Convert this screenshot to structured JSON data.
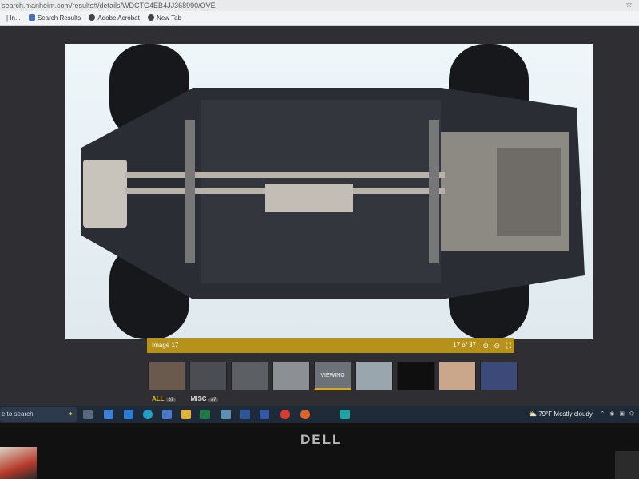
{
  "browser": {
    "url": "search.manheim.com/results#/details/WDCTG4EB4JJ368990/OVE",
    "bookmarks": [
      {
        "label": "| In...",
        "icon": "page-icon",
        "color": "#888888"
      },
      {
        "label": "Search Results",
        "icon": "search-results-icon",
        "color": "#4a6fb5"
      },
      {
        "label": "Adobe Acrobat",
        "icon": "acrobat-icon",
        "color": "#444444"
      },
      {
        "label": "New Tab",
        "icon": "globe-icon",
        "color": "#444444"
      }
    ]
  },
  "viewer": {
    "image_label": "Image 17",
    "counter": "17 of 37",
    "viewing_label": "VIEWING",
    "thumbnails": [
      {
        "name": "interior-seats",
        "color": "#6a5a4e"
      },
      {
        "name": "trunk-cargo",
        "color": "#4b4d52"
      },
      {
        "name": "engine-bay",
        "color": "#5c5f64"
      },
      {
        "name": "rear-hatch",
        "color": "#8c8f94"
      },
      {
        "name": "viewing",
        "color": "#6d7278"
      },
      {
        "name": "side-mirror",
        "color": "#9aa6ae"
      },
      {
        "name": "dark-image",
        "color": "#0f0f10"
      },
      {
        "name": "tan-panel",
        "color": "#caa78a"
      },
      {
        "name": "exterior-lot",
        "color": "#3c4a7a"
      }
    ],
    "filters": {
      "all_label": "ALL",
      "all_count": "37",
      "misc_label": "MISC",
      "misc_count": "37"
    }
  },
  "taskbar": {
    "search_placeholder": "e to search",
    "weather_temp": "79°F",
    "weather_text": "Mostly cloudy"
  },
  "monitor": {
    "brand": "DELL"
  },
  "colors": {
    "accent": "#b6921a",
    "page_bg": "#2f2f33",
    "taskbar": "#1f2a38"
  }
}
